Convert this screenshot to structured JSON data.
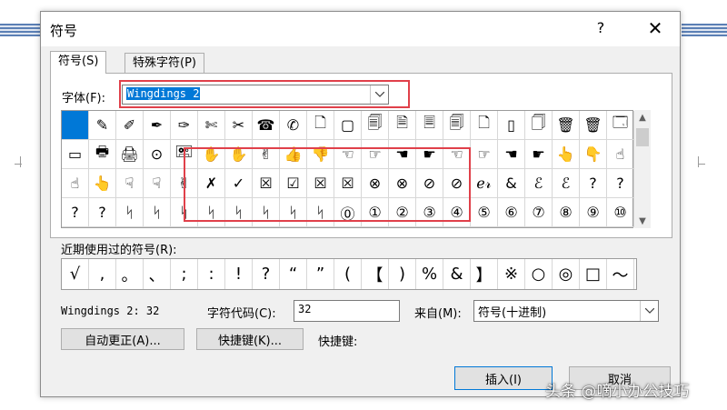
{
  "dialog": {
    "title": "符号",
    "help": "?",
    "close": "✕"
  },
  "tabs": [
    {
      "label": "符号(S)"
    },
    {
      "label": "特殊字符(P)"
    }
  ],
  "font": {
    "label": "字体(F):",
    "value": "Wingdings 2"
  },
  "grid": {
    "rows": [
      [
        "",
        "✎",
        "✐",
        "✒",
        "✑",
        "✄",
        "✂",
        "☎",
        "✆",
        "🗋",
        "▢",
        "🗐",
        "🗎",
        "🗏",
        "🗐",
        "🗋",
        "▯",
        "🗍",
        "🗑",
        "🗑",
        "🗔"
      ],
      [
        "▭",
        "🖶",
        "🖨",
        "⊙",
        "🖭",
        "✋",
        "✋",
        "✌",
        "👍",
        "👎",
        "☜",
        "☞",
        "☚",
        "☛",
        "☜",
        "☞",
        "☚",
        "☛",
        "👆",
        "👇",
        "☝"
      ],
      [
        "☝",
        "👆",
        "☟",
        "☟",
        "✌",
        "✗",
        "✓",
        "☒",
        "☑",
        "☒",
        "☒",
        "⊗",
        "⊗",
        "⊘",
        "⊘",
        "ℯ𝓇",
        "&",
        "ℰ",
        "ℰ",
        "?",
        "?"
      ],
      [
        "?",
        "?",
        "ᛋ",
        "ᛋ",
        "ᛋ",
        "ᛋ",
        "ᛋ",
        "ᛋ",
        "ᛋ",
        "ᛋ",
        "⓪",
        "①",
        "②",
        "③",
        "④",
        "⑤",
        "⑥",
        "⑦",
        "⑧",
        "⑨",
        "⑩"
      ]
    ]
  },
  "recent": {
    "label": "近期使用过的符号(R):",
    "items": [
      "√",
      ",",
      "。",
      "、",
      ";",
      ":",
      "!",
      "?",
      "“",
      "”",
      "(",
      "【",
      ")",
      "%",
      "&",
      "】",
      "※",
      "○",
      "◎",
      "□",
      "～"
    ]
  },
  "info": {
    "font_code": "Wingdings 2: 32",
    "char_code_label": "字符代码(C):",
    "char_code_value": "32",
    "from_label": "来自(M):",
    "from_value": "符号(十进制)",
    "shortcut_label": "快捷键:"
  },
  "buttons": {
    "autocorrect": "自动更正(A)...",
    "shortcut_key": "快捷键(K)...",
    "insert": "插入(I)",
    "cancel": "取消"
  },
  "watermark": "头条 @嘀小办公技巧",
  "colors": {
    "highlight": "#0078d7",
    "annotation": "#e0404a"
  }
}
